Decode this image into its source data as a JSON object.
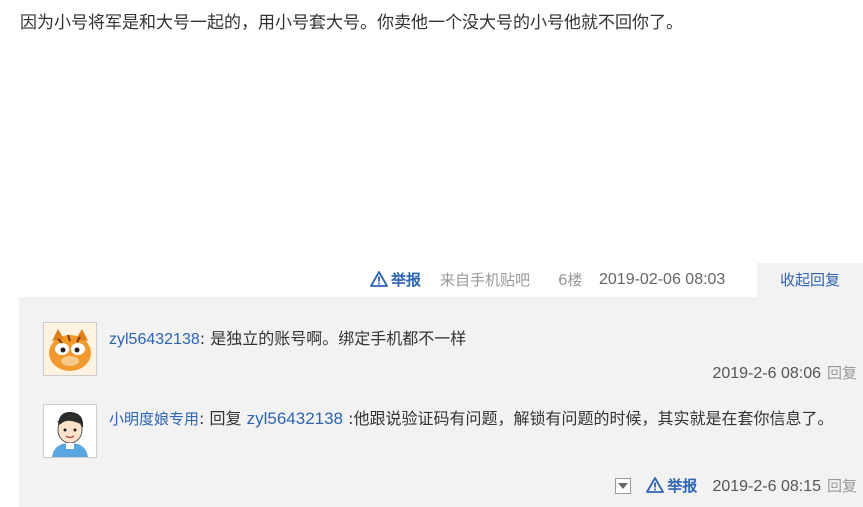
{
  "post": {
    "content": "因为小号将军是和大号一起的，用小号套大号。你卖他一个没大号的小号他就不回你了。"
  },
  "tail": {
    "report_label": "举报",
    "source": "来自手机贴吧",
    "floor": "6楼",
    "time": "2019-02-06 08:03",
    "collapse_label": "收起回复"
  },
  "replies": [
    {
      "username": "zyl56432138",
      "separator": ":",
      "text": " 是独立的账号啊。绑定手机都不一样",
      "time": "2019-2-6 08:06",
      "reply_label": "回复"
    },
    {
      "username": "小明度娘专用",
      "separator": ":",
      "reply_prefix": " 回复 ",
      "reply_target": "zyl56432138",
      "text": " :他跟说验证码有问题，解锁有问题的时候，其实就是在套你信息了。",
      "report_label": "举报",
      "time": "2019-2-6 08:15",
      "reply_label": "回复"
    }
  ],
  "colors": {
    "link_blue": "#2d64b3",
    "reply_bg": "#f2f2f2",
    "meta_gray": "#999999"
  },
  "icons": {
    "report": "warning-triangle-icon",
    "menu": "dropdown-arrow-icon"
  }
}
